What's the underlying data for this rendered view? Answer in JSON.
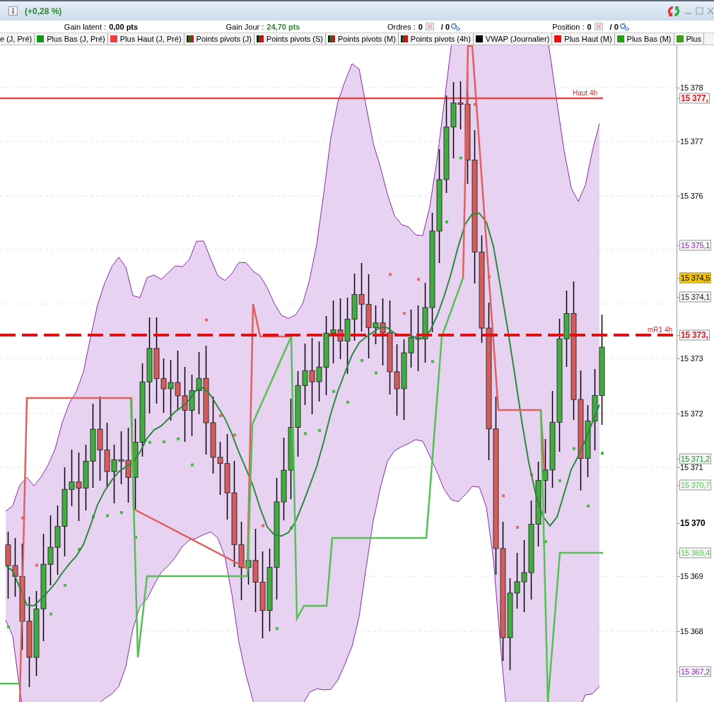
{
  "window": {
    "change": "(+0,28 %)"
  },
  "status": [
    {
      "label": "Gain latent :",
      "value": "0,00 pts",
      "kind": "plain"
    },
    {
      "label": "Gain Jour :",
      "value": "24,70 pts",
      "kind": "positive"
    },
    {
      "label": "Ordres :",
      "value": "0",
      "total": "/ 0",
      "kind": "counter"
    },
    {
      "label": "Position :",
      "value": "0",
      "total": "/ 0",
      "kind": "counter"
    }
  ],
  "legend": [
    {
      "label": "e (J, Pré)",
      "kind": "none"
    },
    {
      "label": "Plus Bas (J, Pré)",
      "kind": "solid",
      "color": "#13931a"
    },
    {
      "label": "Plus Haut (J, Pré)",
      "kind": "solid",
      "color": "#ee3b3b"
    },
    {
      "label": "Points pivots (J)",
      "kind": "pivot",
      "color": "#c01818"
    },
    {
      "label": "Points pivots (S)",
      "kind": "pivot",
      "color": "#c01818"
    },
    {
      "label": "Points pivots (M)",
      "kind": "pivot",
      "color": "#c01818"
    },
    {
      "label": "Points pivots (4h)",
      "kind": "pivot",
      "color": "#c01818"
    },
    {
      "label": "VWAP (Journalier)",
      "kind": "solid",
      "color": "#000000"
    },
    {
      "label": "Plus Haut (M)",
      "kind": "solid",
      "color": "#ee1111"
    },
    {
      "label": "Plus Bas (M)",
      "kind": "solid",
      "color": "#2a9a1a"
    },
    {
      "label": "Plus",
      "kind": "solid",
      "color": "#3c9c1c"
    }
  ],
  "chart": {
    "annotations": [
      "Haut 4h",
      "mR1 4h"
    ],
    "axis": [
      {
        "text": "15 378",
        "kind": "tick"
      },
      {
        "text": "15 377,",
        "kind": "tag-bold",
        "color": "#d62020"
      },
      {
        "text": "15 377",
        "kind": "tick"
      },
      {
        "text": "15 376",
        "kind": "tick"
      },
      {
        "text": "15 375,1",
        "kind": "tag",
        "color": "#8a2aa8"
      },
      {
        "text": "15 374,5",
        "kind": "tag-filled",
        "color": "#f3c400"
      },
      {
        "text": "15 374,1",
        "kind": "tag",
        "color": "#222222"
      },
      {
        "text": "15 373,",
        "kind": "tag-bold",
        "color": "#d62020"
      },
      {
        "text": "15 373",
        "kind": "tick"
      },
      {
        "text": "15 372",
        "kind": "tick"
      },
      {
        "text": "15 371,2",
        "kind": "tag",
        "color": "#1f8a3a"
      },
      {
        "text": "15 371",
        "kind": "tick"
      },
      {
        "text": "15 370,7",
        "kind": "tag",
        "color": "#5cc05c"
      },
      {
        "text": "15 370",
        "kind": "tick-bold"
      },
      {
        "text": "15 369,4",
        "kind": "tag",
        "color": "#5cc05c"
      },
      {
        "text": "15 369",
        "kind": "tick"
      },
      {
        "text": "15 368",
        "kind": "tick"
      },
      {
        "text": "15 367,2",
        "kind": "tag",
        "color": "#8a2aa8"
      }
    ]
  }
}
